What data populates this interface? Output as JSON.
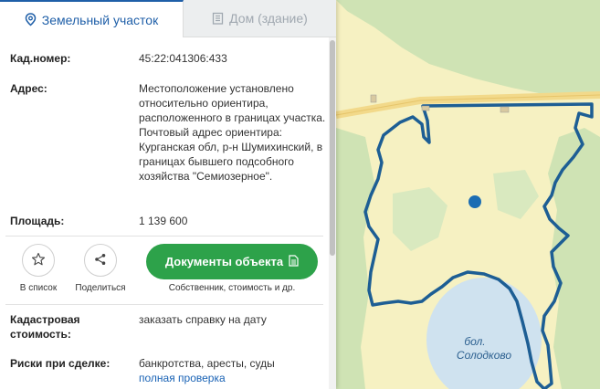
{
  "tabs": [
    {
      "label": "Земельный участок",
      "icon": "map-pin-icon",
      "active": true
    },
    {
      "label": "Дом (здание)",
      "icon": "building-icon",
      "active": false
    }
  ],
  "info": {
    "cadastral_number": {
      "label": "Кад.номер:",
      "value": "45:22:041306:433"
    },
    "address": {
      "label": "Адрес:",
      "value": "Местоположение установлено относительно ориентира, расположенного в границах участка. Почтовый адрес ориентира: Курганская обл, р-н Шумихинский, в границах бывшего подсобного хозяйства \"Семиозерное\"."
    },
    "area": {
      "label": "Площадь:",
      "value": "1 139 600"
    }
  },
  "actions": {
    "add_to_list": {
      "label": "В список",
      "icon": "star-icon"
    },
    "share": {
      "label": "Поделиться",
      "icon": "share-icon"
    },
    "documents": {
      "label": "Документы объекта",
      "sublabel": "Собственник, стоимость и др.",
      "icon": "document-icon"
    }
  },
  "cadastral_value": {
    "label": "Кадастровая стоимость:",
    "link": "заказать справку на дату"
  },
  "risks": {
    "label": "Риски при сделке:",
    "value": "банкротства, аресты, суды",
    "link": "полная проверка"
  },
  "map": {
    "lake_label_line1": "бол.",
    "lake_label_line2": "Солодково",
    "colors": {
      "field": "#f6f1c2",
      "forest": "#cfe3b4",
      "lake": "#cfe2ef",
      "boundary": "#1d5e94",
      "marker": "#1b6db3"
    }
  },
  "colors": {
    "accent": "#1f5fa8",
    "green_button": "#2da24a",
    "link": "#1a63b5"
  }
}
